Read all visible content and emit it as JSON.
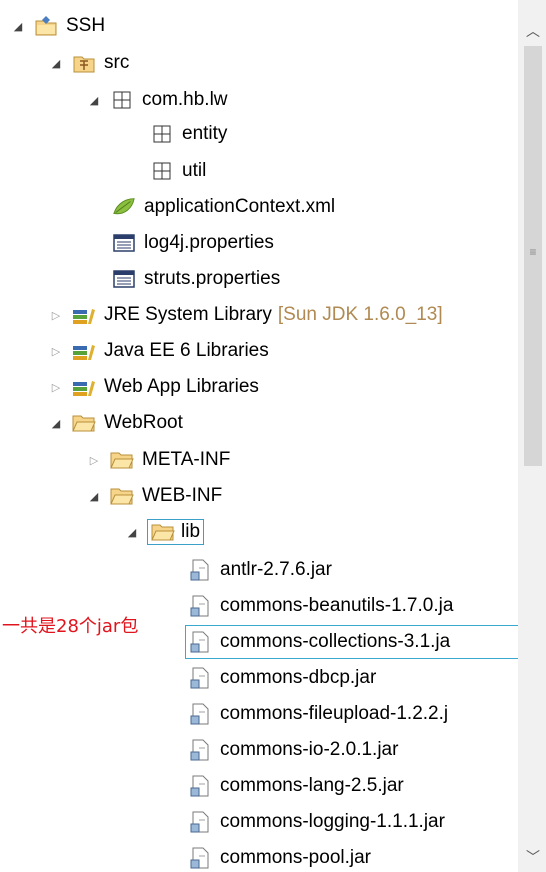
{
  "tree": {
    "project": {
      "label": "SSH"
    },
    "src": {
      "label": "src"
    },
    "package": {
      "label": "com.hb.lw"
    },
    "entity": {
      "label": "entity"
    },
    "util": {
      "label": "util"
    },
    "appctx": {
      "label": "applicationContext.xml"
    },
    "log4j": {
      "label": "log4j.properties"
    },
    "struts": {
      "label": "struts.properties"
    },
    "jre": {
      "label": "JRE System Library",
      "decoration": "[Sun JDK 1.6.0_13]"
    },
    "javaee": {
      "label": "Java EE 6 Libraries"
    },
    "webapp": {
      "label": "Web App Libraries"
    },
    "webroot": {
      "label": "WebRoot"
    },
    "metainf": {
      "label": "META-INF"
    },
    "webinf": {
      "label": "WEB-INF"
    },
    "lib": {
      "label": "lib"
    },
    "jars": [
      "antlr-2.7.6.jar",
      "commons-beanutils-1.7.0.ja",
      "commons-collections-3.1.ja",
      "commons-dbcp.jar",
      "commons-fileupload-1.2.2.j",
      "commons-io-2.0.1.jar",
      "commons-lang-2.5.jar",
      "commons-logging-1.1.1.jar",
      "commons-pool.jar"
    ]
  },
  "annotation": {
    "text": "一共是28个jar包",
    "color": "#e0141c"
  },
  "colors": {
    "selection": "#39a9d0",
    "decoration": "#b08a52"
  },
  "icons": {
    "expanded": "triangle-expanded-icon",
    "collapsed": "triangle-collapsed-icon",
    "project": "project-icon",
    "source-folder": "source-folder-icon",
    "package": "package-icon",
    "xml": "spring-xml-icon",
    "properties": "properties-file-icon",
    "library": "library-icon",
    "folder": "folder-icon",
    "jar": "jar-icon"
  }
}
